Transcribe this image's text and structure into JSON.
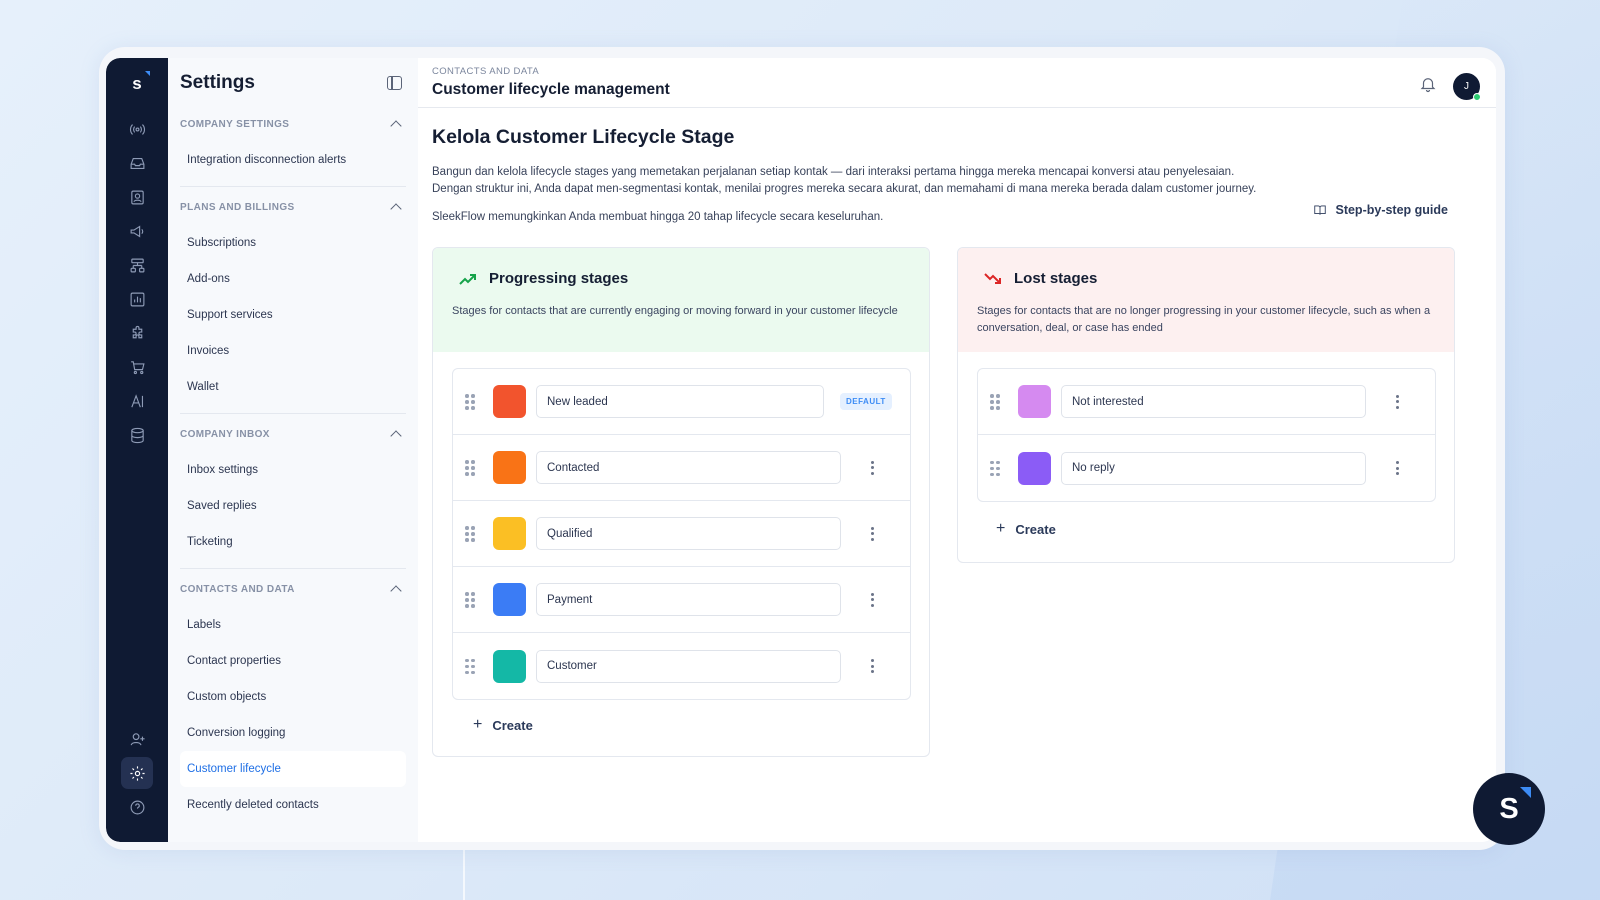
{
  "rail": {
    "logo": "s",
    "icons": [
      "broadcast-icon",
      "inbox-icon",
      "contacts-icon",
      "megaphone-icon",
      "flow-icon",
      "analytics-icon",
      "puzzle-icon",
      "cart-icon",
      "ai-icon",
      "database-icon"
    ],
    "bottom_icons": [
      "add-user-icon",
      "gear-icon",
      "help-icon"
    ]
  },
  "sidebar": {
    "title": "Settings",
    "sections": [
      {
        "title": "COMPANY SETTINGS",
        "items": [
          "Integration disconnection alerts"
        ]
      },
      {
        "title": "PLANS AND BILLINGS",
        "items": [
          "Subscriptions",
          "Add-ons",
          "Support services",
          "Invoices",
          "Wallet"
        ]
      },
      {
        "title": "COMPANY INBOX",
        "items": [
          "Inbox settings",
          "Saved replies",
          "Ticketing"
        ]
      },
      {
        "title": "CONTACTS AND DATA",
        "items": [
          "Labels",
          "Contact properties",
          "Custom objects",
          "Conversion logging",
          "Customer lifecycle",
          "Recently deleted contacts"
        ]
      }
    ],
    "active_item": "Customer lifecycle"
  },
  "header": {
    "breadcrumb": "CONTACTS AND DATA",
    "title": "Customer lifecycle management",
    "avatar_initial": "J"
  },
  "main": {
    "heading": "Kelola Customer Lifecycle Stage",
    "description": "Bangun dan kelola lifecycle stages yang memetakan perjalanan setiap kontak — dari interaksi pertama hingga mereka mencapai konversi atau penyelesaian. Dengan struktur ini, Anda dapat men-segmentasi kontak, menilai progres mereka secara akurat, dan memahami di mana mereka berada dalam customer journey.",
    "limit_note": "SleekFlow memungkinkan Anda membuat hingga 20 tahap lifecycle secara keseluruhan.",
    "guide_label": "Step-by-step guide",
    "progressing": {
      "title": "Progressing stages",
      "description": "Stages for contacts that are currently engaging or moving forward in your customer lifecycle",
      "stages": [
        {
          "name": "New leaded",
          "color": "#f2542d",
          "badge": "DEFAULT"
        },
        {
          "name": "Contacted",
          "color": "#f97316"
        },
        {
          "name": "Qualified",
          "color": "#fbbf24"
        },
        {
          "name": "Payment",
          "color": "#3b7cf5"
        },
        {
          "name": "Customer",
          "color": "#14b8a6"
        }
      ],
      "create_label": "Create"
    },
    "lost": {
      "title": "Lost stages",
      "description": "Stages for contacts that are no longer progressing in your customer lifecycle, such as when a conversation, deal, or case has ended",
      "stages": [
        {
          "name": "Not interested",
          "color": "#d58af0"
        },
        {
          "name": "No reply",
          "color": "#8b5cf6"
        }
      ],
      "create_label": "Create"
    }
  },
  "fab": {
    "label": "S"
  },
  "colors": {
    "rail": "#0f1a33",
    "accent": "#1f6fe5",
    "progressing_bg": "#ebfaef",
    "lost_bg": "#fdf0f0"
  }
}
